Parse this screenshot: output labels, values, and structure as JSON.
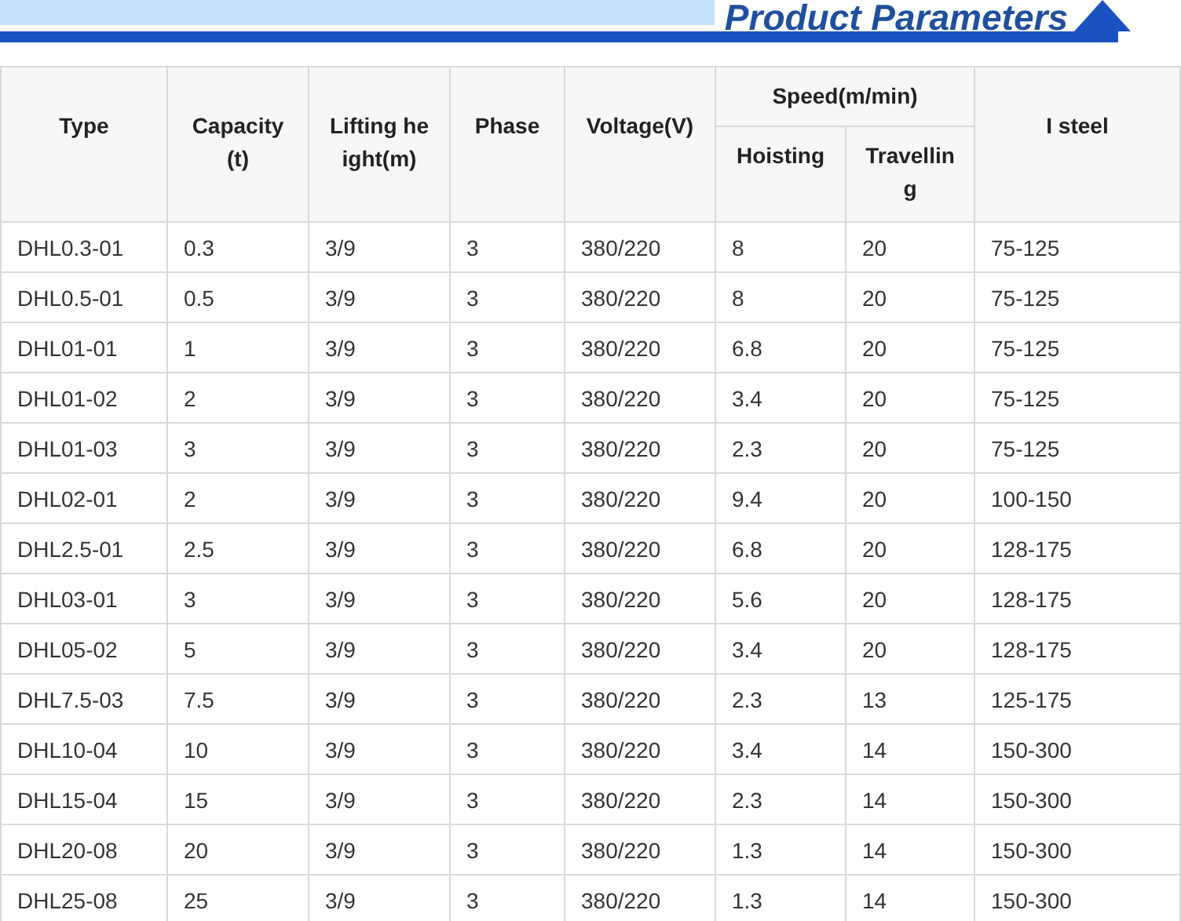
{
  "banner": {
    "title": "Product Parameters"
  },
  "table": {
    "column_groups": [
      {
        "label": "Speed(m/min)"
      }
    ],
    "columns": [
      {
        "label": "Type",
        "in_group": false
      },
      {
        "label": "Capacity(t)",
        "in_group": false
      },
      {
        "label": "Lifting height(m)",
        "in_group": false
      },
      {
        "label": "Phase",
        "in_group": false
      },
      {
        "label": "Voltage(V)",
        "in_group": false
      },
      {
        "label": "Hoisting",
        "in_group": true
      },
      {
        "label": "Travelling",
        "in_group": true
      },
      {
        "label": "I steel",
        "in_group": false
      }
    ],
    "rows": [
      [
        "DHL0.3-01",
        "0.3",
        "3/9",
        "3",
        "380/220",
        "8",
        "20",
        "75-125"
      ],
      [
        "DHL0.5-01",
        "0.5",
        "3/9",
        "3",
        "380/220",
        "8",
        "20",
        "75-125"
      ],
      [
        "DHL01-01",
        "1",
        "3/9",
        "3",
        "380/220",
        "6.8",
        "20",
        "75-125"
      ],
      [
        "DHL01-02",
        "2",
        "3/9",
        "3",
        "380/220",
        "3.4",
        "20",
        "75-125"
      ],
      [
        "DHL01-03",
        "3",
        "3/9",
        "3",
        "380/220",
        "2.3",
        "20",
        "75-125"
      ],
      [
        "DHL02-01",
        "2",
        "3/9",
        "3",
        "380/220",
        "9.4",
        "20",
        "100-150"
      ],
      [
        "DHL2.5-01",
        "2.5",
        "3/9",
        "3",
        "380/220",
        "6.8",
        "20",
        "128-175"
      ],
      [
        "DHL03-01",
        "3",
        "3/9",
        "3",
        "380/220",
        "5.6",
        "20",
        "128-175"
      ],
      [
        "DHL05-02",
        "5",
        "3/9",
        "3",
        "380/220",
        "3.4",
        "20",
        "128-175"
      ],
      [
        "DHL7.5-03",
        "7.5",
        "3/9",
        "3",
        "380/220",
        "2.3",
        "13",
        "125-175"
      ],
      [
        "DHL10-04",
        "10",
        "3/9",
        "3",
        "380/220",
        "3.4",
        "14",
        "150-300"
      ],
      [
        "DHL15-04",
        "15",
        "3/9",
        "3",
        "380/220",
        "2.3",
        "14",
        "150-300"
      ],
      [
        "DHL20-08",
        "20",
        "3/9",
        "3",
        "380/220",
        "1.3",
        "14",
        "150-300"
      ],
      [
        "DHL25-08",
        "25",
        "3/9",
        "3",
        "380/220",
        "1.3",
        "14",
        "150-300"
      ]
    ]
  }
}
